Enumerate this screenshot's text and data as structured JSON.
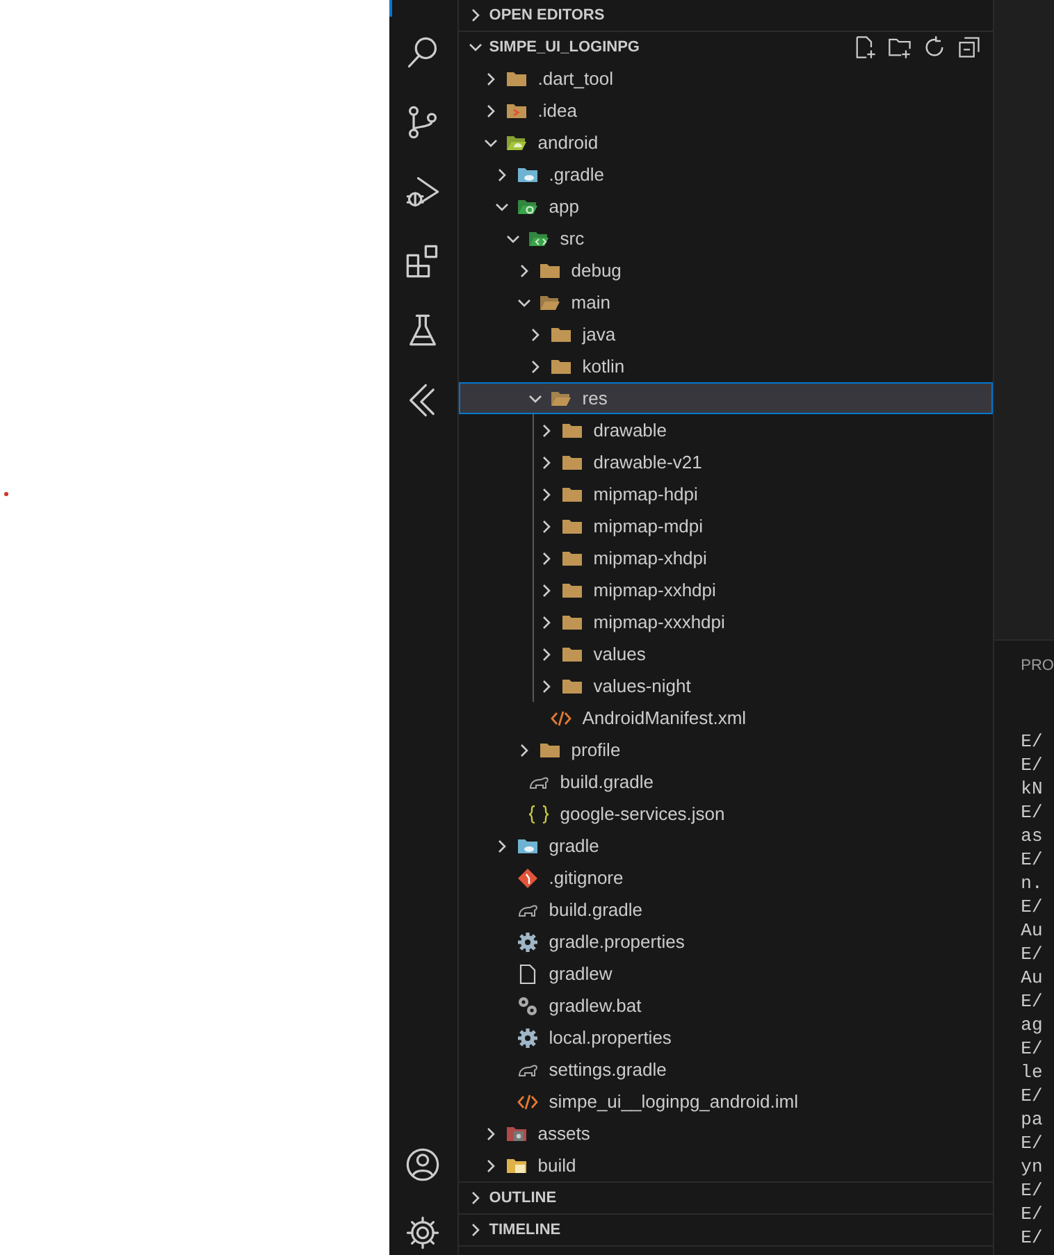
{
  "explorer": {
    "sections": [
      {
        "title": "OPEN EDITORS",
        "expanded": false
      },
      {
        "title": "SIMPE_UI_LOGINPG",
        "expanded": true,
        "tree": [
          {
            "name": ".dart_tool",
            "kind": "folder",
            "expanded": false,
            "selected": false
          },
          {
            "name": ".idea",
            "kind": "idea-folder",
            "expanded": false,
            "selected": false
          },
          {
            "name": "android",
            "kind": "android-folder",
            "expanded": true,
            "selected": false,
            "children": [
              {
                "name": ".gradle",
                "kind": "gradle-folder",
                "expanded": false,
                "selected": false
              },
              {
                "name": "app",
                "kind": "app-folder",
                "expanded": true,
                "selected": false,
                "children": [
                  {
                    "name": "src",
                    "kind": "src-folder",
                    "expanded": true,
                    "selected": false,
                    "children": [
                      {
                        "name": "debug",
                        "kind": "folder",
                        "expanded": false,
                        "selected": false
                      },
                      {
                        "name": "main",
                        "kind": "folder",
                        "expanded": true,
                        "selected": false,
                        "children": [
                          {
                            "name": "java",
                            "kind": "folder",
                            "expanded": false,
                            "selected": false
                          },
                          {
                            "name": "kotlin",
                            "kind": "folder",
                            "expanded": false,
                            "selected": false
                          },
                          {
                            "name": "res",
                            "kind": "folder",
                            "expanded": true,
                            "selected": true,
                            "children": [
                              {
                                "name": "drawable",
                                "kind": "folder",
                                "expanded": false,
                                "selected": false
                              },
                              {
                                "name": "drawable-v21",
                                "kind": "folder",
                                "expanded": false,
                                "selected": false
                              },
                              {
                                "name": "mipmap-hdpi",
                                "kind": "folder",
                                "expanded": false,
                                "selected": false
                              },
                              {
                                "name": "mipmap-mdpi",
                                "kind": "folder",
                                "expanded": false,
                                "selected": false
                              },
                              {
                                "name": "mipmap-xhdpi",
                                "kind": "folder",
                                "expanded": false,
                                "selected": false
                              },
                              {
                                "name": "mipmap-xxhdpi",
                                "kind": "folder",
                                "expanded": false,
                                "selected": false
                              },
                              {
                                "name": "mipmap-xxxhdpi",
                                "kind": "folder",
                                "expanded": false,
                                "selected": false
                              },
                              {
                                "name": "values",
                                "kind": "folder",
                                "expanded": false,
                                "selected": false
                              },
                              {
                                "name": "values-night",
                                "kind": "folder",
                                "expanded": false,
                                "selected": false
                              }
                            ]
                          },
                          {
                            "name": "AndroidManifest.xml",
                            "kind": "xml-file",
                            "selected": false
                          }
                        ]
                      },
                      {
                        "name": "profile",
                        "kind": "folder",
                        "expanded": false,
                        "selected": false
                      }
                    ]
                  },
                  {
                    "name": "build.gradle",
                    "kind": "gradle-file",
                    "selected": false
                  },
                  {
                    "name": "google-services.json",
                    "kind": "json-file",
                    "selected": false
                  }
                ]
              },
              {
                "name": "gradle",
                "kind": "gradle-folder",
                "expanded": false,
                "selected": false
              },
              {
                "name": ".gitignore",
                "kind": "git-file",
                "selected": false
              },
              {
                "name": "build.gradle",
                "kind": "gradle-file",
                "selected": false
              },
              {
                "name": "gradle.properties",
                "kind": "settings-file",
                "selected": false
              },
              {
                "name": "gradlew",
                "kind": "plain-file",
                "selected": false
              },
              {
                "name": "gradlew.bat",
                "kind": "script-file",
                "selected": false
              },
              {
                "name": "local.properties",
                "kind": "settings-file",
                "selected": false
              },
              {
                "name": "settings.gradle",
                "kind": "gradle-file",
                "selected": false
              },
              {
                "name": "simpe_ui__loginpg_android.iml",
                "kind": "xml-file",
                "selected": false
              }
            ]
          },
          {
            "name": "assets",
            "kind": "assets-folder",
            "expanded": false,
            "selected": false
          },
          {
            "name": "build",
            "kind": "build-folder",
            "expanded": false,
            "selected": false
          }
        ]
      },
      {
        "title": "OUTLINE",
        "expanded": false
      },
      {
        "title": "TIMELINE",
        "expanded": false
      }
    ]
  },
  "panel": {
    "tab": "PRO",
    "lines": [
      "E/",
      "E/",
      "kN",
      "E/",
      "as",
      "E/",
      "n.",
      "E/",
      "Au",
      "E/",
      "Au",
      "E/",
      "ag",
      "E/",
      "le",
      "E/",
      "pa",
      "E/",
      "yn",
      "E/",
      "E/",
      "E/"
    ]
  }
}
